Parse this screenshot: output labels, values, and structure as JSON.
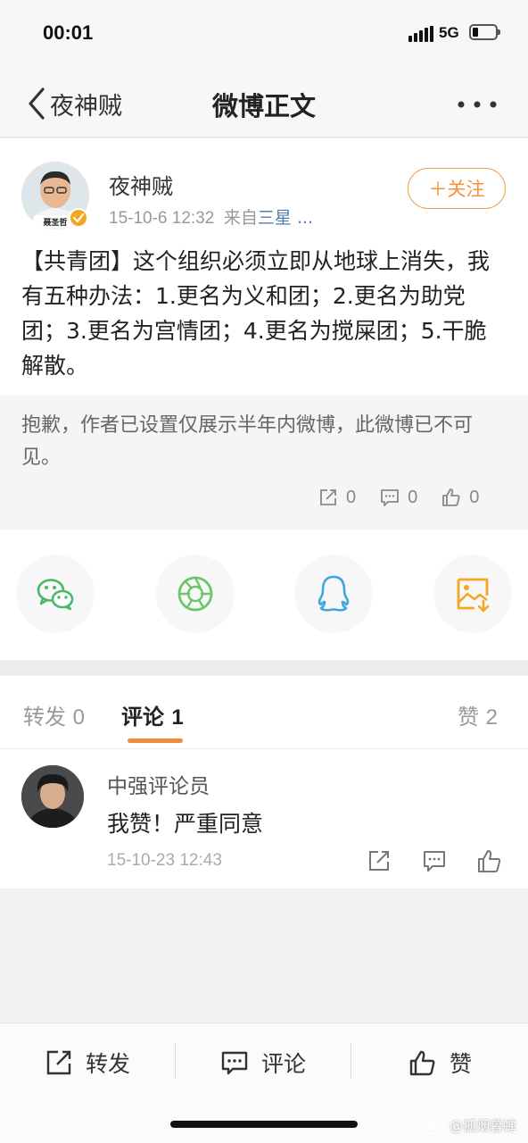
{
  "status_bar": {
    "time": "00:01",
    "network": "5G"
  },
  "nav": {
    "back_label": "夜神贼",
    "title": "微博正文"
  },
  "post": {
    "avatar_caption": "聂圣哲",
    "author": "夜神贼",
    "date": "15-10-6 12:32",
    "source_prefix": "来自",
    "source_name": "三星 ...",
    "follow_label": "＋关注",
    "text": "【共青团】这个组织必须立即从地球上消失，我有五种办法：1.更名为义和团；2.更名为助党团；3.更名为宫情团；4.更名为搅屎团；5.干脆解散。"
  },
  "notice": {
    "text": "抱歉，作者已设置仅展示半年内微博，此微博已不可见。",
    "stats": {
      "repost": "0",
      "comment": "0",
      "like": "0"
    }
  },
  "share_targets": [
    {
      "icon": "wechat-icon",
      "color": "#4ab86a"
    },
    {
      "icon": "moments-icon",
      "color": "#6cc56a"
    },
    {
      "icon": "qq-icon",
      "color": "#3ea7e0"
    },
    {
      "icon": "save-image-icon",
      "color": "#f5a623"
    }
  ],
  "tabs": {
    "repost": {
      "label": "转发",
      "count": "0"
    },
    "comment": {
      "label": "评论",
      "count": "1"
    },
    "like": {
      "label": "赞",
      "count": "2"
    }
  },
  "comment": {
    "user": "中强评论员",
    "text": "我赞！严重同意",
    "time": "15-10-23 12:43"
  },
  "toolbar": {
    "repost": "转发",
    "comment": "评论",
    "like": "赞"
  },
  "watermark": "@孤烟暮蝉",
  "colors": {
    "accent": "#f28a3b",
    "link": "#507daf"
  }
}
